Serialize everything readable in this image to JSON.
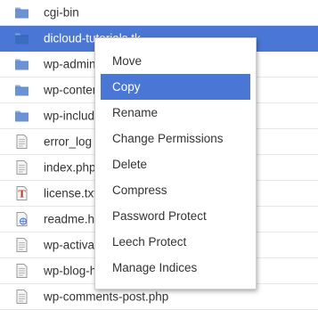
{
  "files": [
    {
      "name": "cgi-bin",
      "icon": "folder-icon",
      "selected": false
    },
    {
      "name": "dicloud-tutorials.tk",
      "icon": "folder-icon",
      "selected": true
    },
    {
      "name": "wp-admin",
      "icon": "folder-icon",
      "selected": false
    },
    {
      "name": "wp-content",
      "icon": "folder-icon",
      "selected": false
    },
    {
      "name": "wp-includes",
      "icon": "folder-icon",
      "selected": false
    },
    {
      "name": "error_log",
      "icon": "text-file-icon",
      "selected": false
    },
    {
      "name": "index.php",
      "icon": "text-file-icon",
      "selected": false
    },
    {
      "name": "license.txt",
      "icon": "text-document-icon",
      "selected": false
    },
    {
      "name": "readme.html",
      "icon": "web-file-icon",
      "selected": false
    },
    {
      "name": "wp-activate.php",
      "icon": "text-file-icon",
      "selected": false
    },
    {
      "name": "wp-blog-header.php",
      "icon": "text-file-icon",
      "selected": false
    },
    {
      "name": "wp-comments-post.php",
      "icon": "text-file-icon",
      "selected": false
    }
  ],
  "context_menu": {
    "items": [
      {
        "label": "Move",
        "highlighted": false
      },
      {
        "label": "Copy",
        "highlighted": true
      },
      {
        "label": "Rename",
        "highlighted": false
      },
      {
        "label": "Change Permissions",
        "highlighted": false
      },
      {
        "label": "Delete",
        "highlighted": false
      },
      {
        "label": "Compress",
        "highlighted": false
      },
      {
        "label": "Password Protect",
        "highlighted": false
      },
      {
        "label": "Leech Protect",
        "highlighted": false
      },
      {
        "label": "Manage Indices",
        "highlighted": false
      }
    ]
  },
  "colors": {
    "selection": "#4a77d6",
    "folder_body": "#5b84c8",
    "folder_tab": "#8eaee0"
  }
}
